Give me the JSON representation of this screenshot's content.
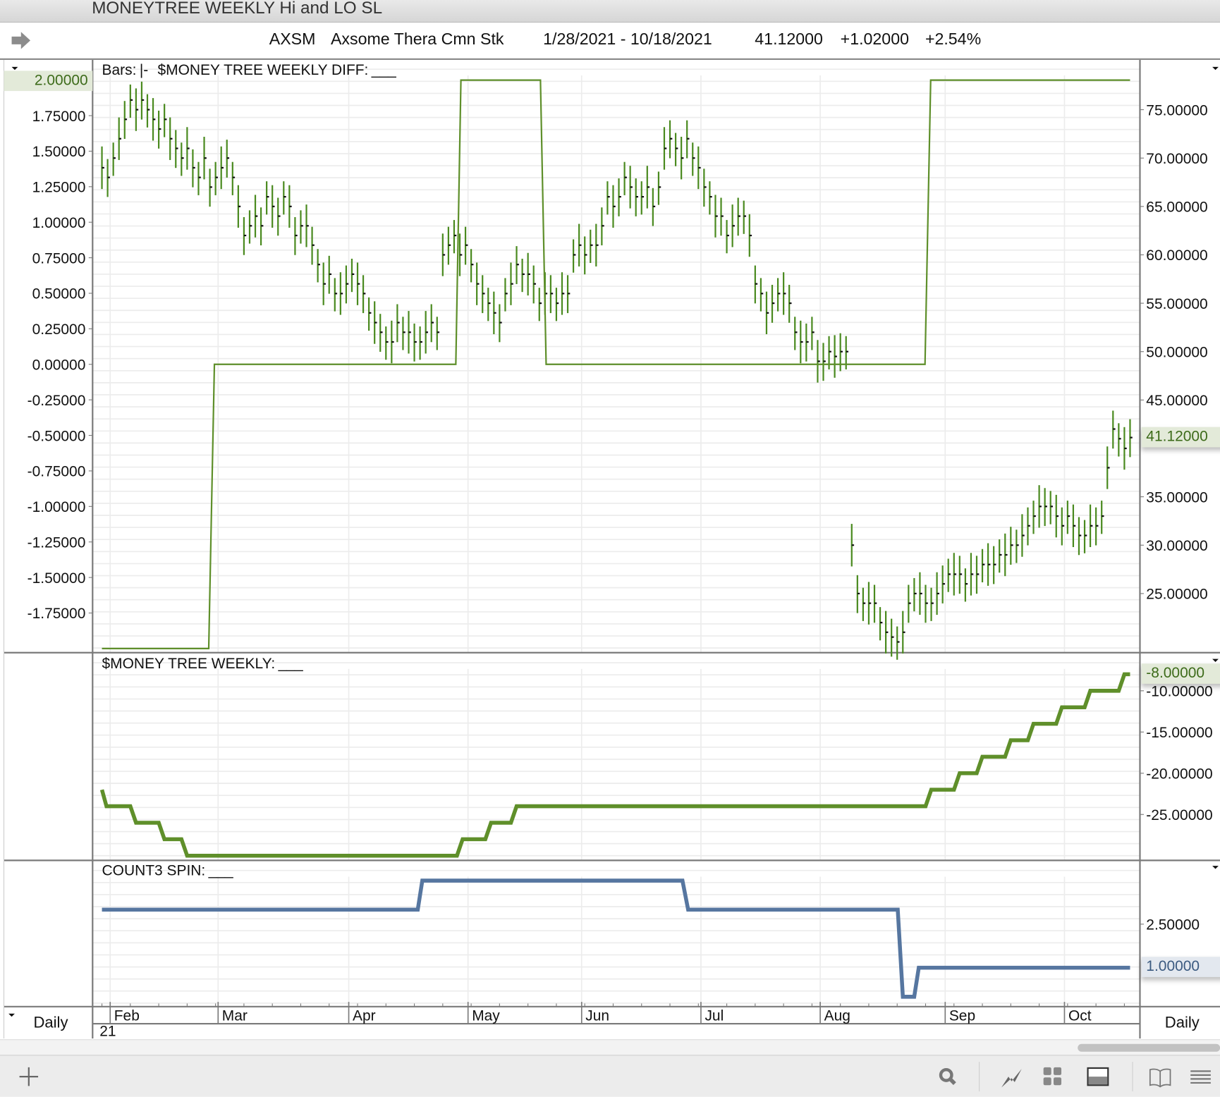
{
  "window": {
    "title": "MONEYTREE WEEKLY Hi and LO SL"
  },
  "header": {
    "symbol": "AXSM",
    "name": "Axsome Thera Cmn Stk",
    "date_range": "1/28/2021 - 10/18/2021",
    "last": "41.12000",
    "change": "+1.02000",
    "change_pct": "+2.54%"
  },
  "colors": {
    "price": "#4a8a1f",
    "diff": "#5e8f2a",
    "weekly": "#5f8f2a",
    "count3": "#5676a0",
    "grid": "#ececec",
    "axis": "#7a7a7a"
  },
  "footer": {
    "interval_left": "Daily",
    "interval_right": "Daily",
    "year_label": "21"
  },
  "toolbar": {
    "icons": [
      "plus-icon",
      "search-icon",
      "chart-icon",
      "grid-icon",
      "panel-icon",
      "book-icon",
      "menu-icon"
    ]
  },
  "chart_data": [
    {
      "type": "bar",
      "name": "price",
      "legend": {
        "bars_label": "Bars:",
        "bars_symbol": "|-",
        "diff_label": "$MONEY TREE WEEKLY DIFF:",
        "diff_symbol": "___"
      },
      "right_axis": {
        "ticks": [
          "75.00000",
          "70.00000",
          "65.00000",
          "60.00000",
          "55.00000",
          "50.00000",
          "45.00000",
          "35.00000",
          "30.00000",
          "25.00000"
        ],
        "tick_values": [
          75,
          70,
          65,
          60,
          55,
          50,
          45,
          35,
          30,
          25
        ],
        "current": "41.12000",
        "current_value": 41.12
      },
      "left_axis": {
        "ticks": [
          "1.75000",
          "1.50000",
          "1.25000",
          "1.00000",
          "0.75000",
          "0.50000",
          "0.25000",
          "0.00000",
          "-0.25000",
          "-0.50000",
          "-0.75000",
          "-1.00000",
          "-1.25000",
          "-1.50000",
          "-1.75000"
        ],
        "tick_values": [
          1.75,
          1.5,
          1.25,
          1,
          0.75,
          0.5,
          0.25,
          0,
          -0.25,
          -0.5,
          -0.75,
          -1,
          -1.25,
          -1.5,
          -1.75
        ],
        "current": "2.00000",
        "current_value": 2
      },
      "bar_half_range": 2.2,
      "close": [
        69,
        68,
        70,
        72,
        74,
        76,
        75,
        76,
        75,
        74,
        73,
        74,
        72,
        71,
        70,
        71,
        69,
        68,
        70,
        67,
        68,
        69,
        70,
        68,
        65,
        62,
        63,
        64,
        63,
        66,
        65,
        64,
        66,
        65,
        62,
        63,
        63,
        61,
        59,
        57,
        58,
        56,
        56,
        57,
        58,
        57,
        56,
        54,
        53,
        52,
        51,
        51,
        53,
        52,
        52,
        51,
        51,
        52,
        53,
        52,
        60,
        61,
        62,
        60,
        61,
        59,
        57,
        56,
        55,
        54,
        53,
        56,
        57,
        59,
        58,
        58,
        57,
        55,
        56,
        56,
        55,
        56,
        56,
        60,
        61,
        60,
        61,
        61,
        63,
        66,
        65,
        66,
        68,
        67,
        66,
        66,
        67,
        65,
        67,
        71,
        72,
        71,
        70,
        72,
        70,
        69,
        67,
        66,
        64,
        64,
        62,
        63,
        64,
        64,
        62,
        57,
        56,
        54,
        55,
        56,
        56,
        55,
        52,
        51,
        51,
        52,
        49,
        49,
        50,
        49.5,
        50,
        50,
        30,
        25,
        24,
        24,
        24,
        22,
        21,
        20.5,
        20,
        21,
        24,
        25,
        25,
        24,
        24,
        25,
        26,
        27,
        27,
        27,
        26,
        27,
        27,
        28,
        28,
        28,
        29,
        29,
        30,
        30,
        31,
        32,
        33,
        34,
        34,
        34,
        33,
        32,
        33,
        32,
        31,
        31,
        32,
        32,
        33,
        38,
        42,
        41,
        40,
        41.12
      ],
      "diff_series": [
        [
          0,
          -2
        ],
        [
          18.8,
          -2
        ],
        [
          19.8,
          0
        ],
        [
          62.3,
          0
        ],
        [
          63.2,
          2
        ],
        [
          77.2,
          2
        ],
        [
          78.2,
          0
        ],
        [
          144.9,
          0
        ],
        [
          145.9,
          2
        ],
        [
          181,
          2
        ]
      ]
    },
    {
      "type": "line",
      "name": "money_tree_weekly",
      "legend": {
        "label": "$MONEY TREE WEEKLY:",
        "symbol": "___"
      },
      "right_axis": {
        "ticks": [
          "-10.00000",
          "-15.00000",
          "-20.00000",
          "-25.00000"
        ],
        "tick_values": [
          -10,
          -15,
          -20,
          -25
        ],
        "current": "-8.00000",
        "current_value": -8
      },
      "series": [
        [
          0,
          -22
        ],
        [
          0.8,
          -24
        ],
        [
          5,
          -24
        ],
        [
          6,
          -26
        ],
        [
          10,
          -26
        ],
        [
          11,
          -28
        ],
        [
          14,
          -28
        ],
        [
          15,
          -30
        ],
        [
          62.5,
          -30
        ],
        [
          63.5,
          -28
        ],
        [
          67.5,
          -28
        ],
        [
          68.5,
          -26
        ],
        [
          72,
          -26
        ],
        [
          73,
          -24
        ],
        [
          145,
          -24
        ],
        [
          146,
          -22
        ],
        [
          150,
          -22
        ],
        [
          151,
          -20
        ],
        [
          154,
          -20
        ],
        [
          155,
          -18
        ],
        [
          159,
          -18
        ],
        [
          160,
          -16
        ],
        [
          163,
          -16
        ],
        [
          164,
          -14
        ],
        [
          168,
          -14
        ],
        [
          169,
          -12
        ],
        [
          173,
          -12
        ],
        [
          174,
          -10
        ],
        [
          179,
          -10
        ],
        [
          180,
          -8
        ],
        [
          181,
          -8
        ]
      ]
    },
    {
      "type": "line",
      "name": "count3_spin",
      "legend": {
        "label": "COUNT3 SPIN:",
        "symbol": "___"
      },
      "right_axis": {
        "ticks": [
          "2.50000"
        ],
        "tick_values": [
          2.5
        ],
        "current": "1.00000",
        "current_value": 1
      },
      "series": [
        [
          0,
          3
        ],
        [
          55.6,
          3
        ],
        [
          56.4,
          4
        ],
        [
          102.2,
          4
        ],
        [
          103.2,
          3
        ],
        [
          140.1,
          3
        ],
        [
          141,
          0
        ],
        [
          143,
          0
        ],
        [
          143.8,
          1
        ],
        [
          181,
          1
        ]
      ]
    }
  ],
  "x_axis": {
    "months": [
      "Feb",
      "Mar",
      "Apr",
      "May",
      "Jun",
      "Jul",
      "Aug",
      "Sep",
      "Oct"
    ],
    "month_start_index": [
      2,
      21,
      44,
      65,
      85,
      106,
      127,
      149,
      170
    ]
  }
}
